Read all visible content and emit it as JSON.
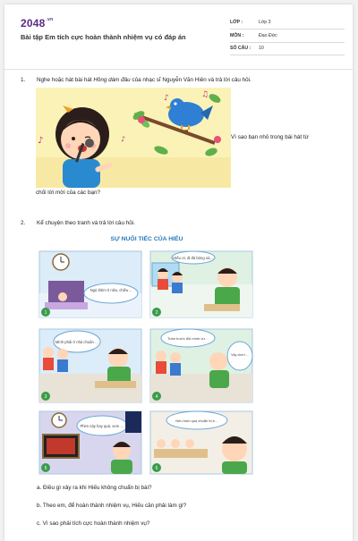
{
  "header": {
    "brand": "2048",
    "brand_suffix": ".vn",
    "title": "Bài tập Em tích cực hoàn thành nhiệm vụ có đáp án",
    "meta": [
      {
        "key": "LỚP :",
        "value": "Lớp 3"
      },
      {
        "key": "MÔN :",
        "value": "Đạo Đức"
      },
      {
        "key": "SỐ CÂU :",
        "value": "10"
      }
    ]
  },
  "questions": [
    {
      "number": "1.",
      "text_before": "Nghe hoặc hát bài hát ",
      "song": "Hồng dám đâu",
      "text_after": " của nhạc sĩ Nguyễn Văn Hiên và trả lời câu hỏi.",
      "side_text": "Vì sao bạn nhỏ trong bài hát từ",
      "continuation": "chối lời mời của các bạn?"
    },
    {
      "number": "2.",
      "text": "Kể chuyện theo tranh và trả lời câu hỏi.",
      "story_title": "SỰ NUỐI TIẾC CỦA HIẾU",
      "panels": [
        {
          "n": "1",
          "bubble": "Ngủ thêm tí nữa, chiều chuẩn bị bài sau"
        },
        {
          "n": "2",
          "bubble": "Hiếu ơi, đi đá bóng nào!"
        },
        {
          "n": "3",
          "bubble": "Mình phải ở nhà chuẩn bị bài cho ngày mai"
        },
        {
          "n": "4",
          "bubble": "Tuần trước đội mình vừa thua, nghỉ còn cần ăn ác quyết",
          "bubble2": "Vậy chơi thôi, tối về chuẩn bị bài cũng được"
        },
        {
          "n": "5",
          "bubble": "Phim này hay quá, xem thêm chút nữa"
        },
        {
          "n": "6",
          "bubble": "Nếu hôm qua chuẩn bị bài tốt, mình đã làm được bài này rồi"
        }
      ],
      "subquestions": [
        "a. Điều gì xảy ra khi Hiếu không chuẩn bị bài?",
        "b. Theo em, để hoàn thành nhiệm vụ, Hiếu cần phải làm gì?",
        "c. Vì sao phải tích cực hoàn thành nhiệm vụ?"
      ]
    }
  ]
}
